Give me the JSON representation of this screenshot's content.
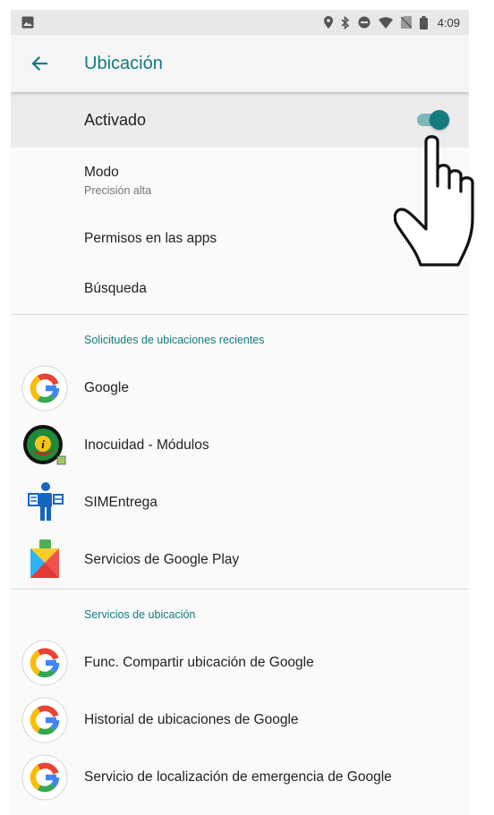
{
  "status_bar": {
    "time": "4:09"
  },
  "toolbar": {
    "title": "Ubicación"
  },
  "master_switch": {
    "label": "Activado",
    "on": true,
    "accent": "#137a80"
  },
  "preferences": [
    {
      "title": "Modo",
      "summary": "Precisión alta"
    },
    {
      "title": "Permisos en las apps"
    },
    {
      "title": "Búsqueda"
    }
  ],
  "recent_requests": {
    "header": "Solicitudes de ubicaciones recientes",
    "apps": [
      {
        "label": "Google",
        "icon": "google-icon"
      },
      {
        "label": "Inocuidad - Módulos",
        "icon": "inocuidad-icon"
      },
      {
        "label": "SIMEntrega",
        "icon": "simentrega-icon"
      },
      {
        "label": "Servicios de Google Play",
        "icon": "google-play-services-icon"
      }
    ]
  },
  "location_services": {
    "header": "Servicios de ubicación",
    "items": [
      {
        "label": "Func. Compartir ubicación de Google",
        "icon": "google-icon"
      },
      {
        "label": "Historial de ubicaciones de Google",
        "icon": "google-icon"
      },
      {
        "label": "Servicio de localización de emergencia de Google",
        "icon": "google-icon"
      }
    ]
  }
}
